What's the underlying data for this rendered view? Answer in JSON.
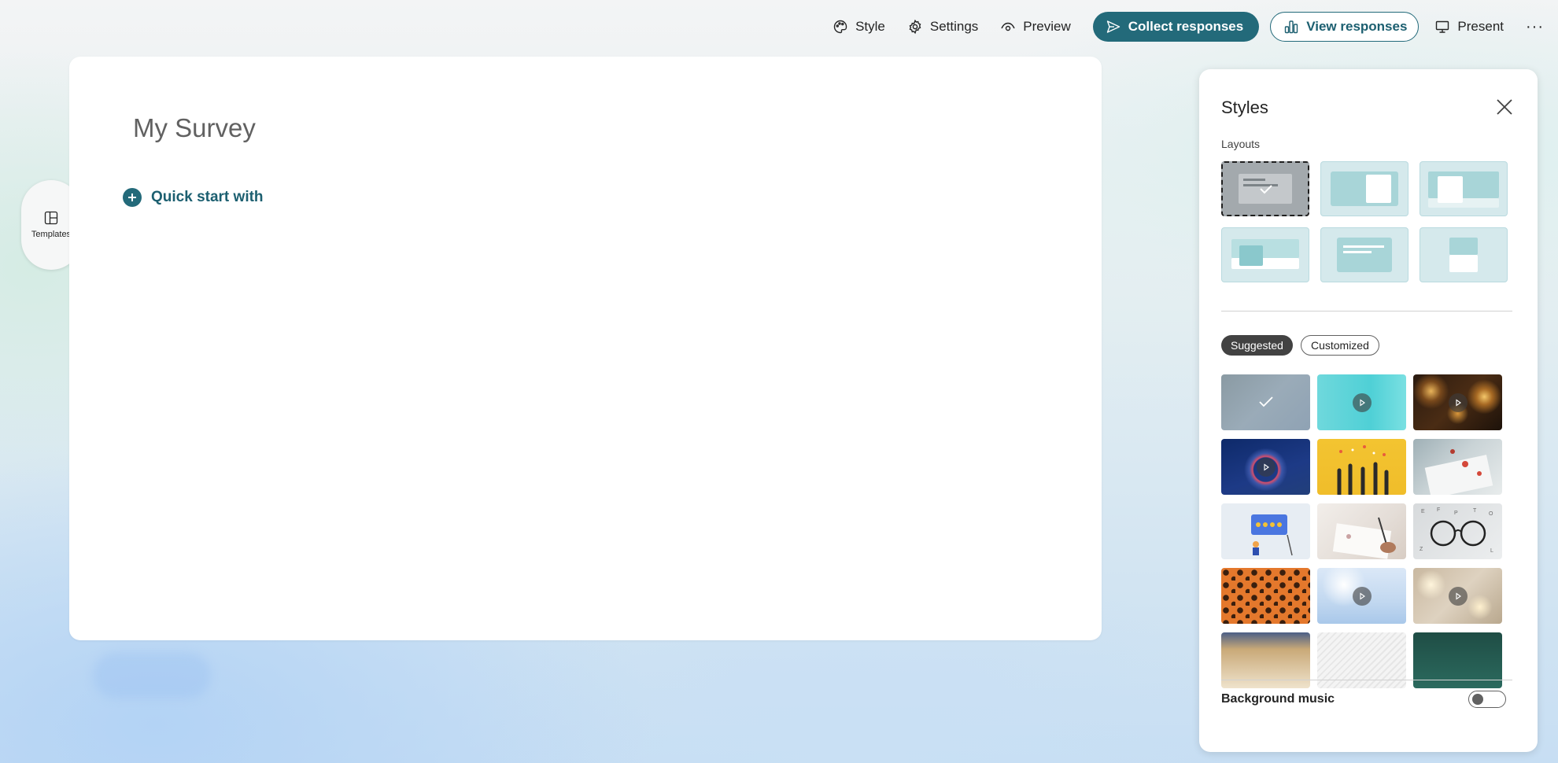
{
  "toolbar": {
    "style_label": "Style",
    "settings_label": "Settings",
    "preview_label": "Preview",
    "collect_label": "Collect responses",
    "view_label": "View responses",
    "present_label": "Present",
    "more_label": "···"
  },
  "rail": {
    "templates_label": "Templates"
  },
  "survey": {
    "title": "My Survey",
    "quick_start_label": "Quick start with"
  },
  "styles_panel": {
    "title": "Styles",
    "layouts_label": "Layouts",
    "selected_layout_index": 0,
    "tabs": {
      "suggested": "Suggested",
      "customized": "Customized",
      "active": "suggested"
    },
    "background_music_label": "Background music",
    "background_music_on": false
  },
  "colors": {
    "accent": "#236a7a",
    "layout_fill": "#d5e9ec",
    "layout_block": "#a8d5d8"
  }
}
